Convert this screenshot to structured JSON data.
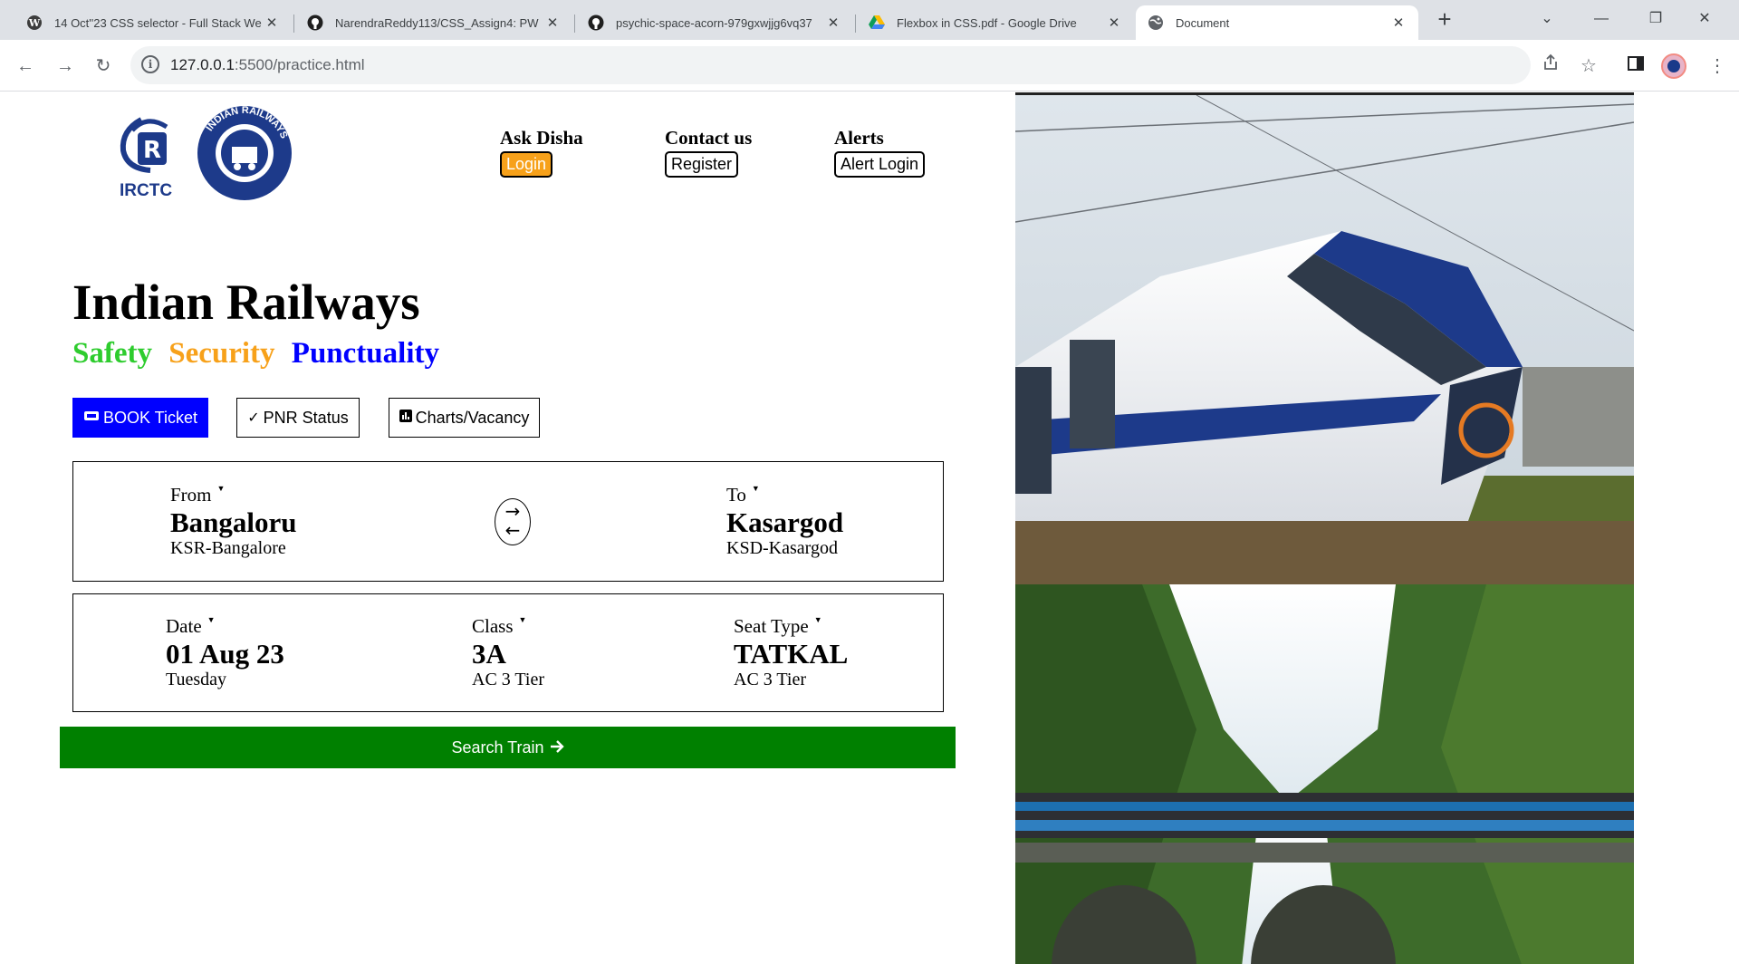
{
  "browser": {
    "tabs": [
      {
        "title": "14 Oct''23 CSS selector - Full Stack We",
        "icon": "wordpress-icon"
      },
      {
        "title": "NarendraReddy113/CSS_Assign4: PW",
        "icon": "github-icon"
      },
      {
        "title": "psychic-space-acorn-979gxwjjg6vq37",
        "icon": "github-icon"
      },
      {
        "title": "Flexbox in CSS.pdf - Google Drive",
        "icon": "google-drive-icon"
      },
      {
        "title": "Document",
        "icon": "globe-icon"
      }
    ],
    "address": {
      "host": "127.0.0.1",
      "path": ":5500/practice.html"
    }
  },
  "logo": {
    "text": "IRCTC",
    "ring_text": "INDIAN RAILWAYS"
  },
  "nav": [
    {
      "heading": "Ask Disha",
      "button": "Login"
    },
    {
      "heading": "Contact us",
      "button": "Register"
    },
    {
      "heading": "Alerts",
      "button": "Alert Login"
    }
  ],
  "headline": "Indian Railways",
  "motto": {
    "safety": "Safety",
    "security": "Security",
    "punctuality": "Punctuality",
    "colors": {
      "safety": "#2ecc2e",
      "security": "#f7a11a",
      "punctuality": "#0000ff"
    }
  },
  "actions": {
    "book": "BOOK Ticket",
    "pnr": "PNR Status",
    "charts": "Charts/Vacancy"
  },
  "journey": {
    "from": {
      "label": "From",
      "city": "Bangaloru",
      "station": "KSR-Bangalore"
    },
    "to": {
      "label": "To",
      "city": "Kasargod",
      "station": "KSD-Kasargod"
    },
    "swap_top": "→",
    "swap_bottom": "←"
  },
  "options": {
    "date": {
      "label": "Date",
      "value": "01 Aug 23",
      "sub": "Tuesday"
    },
    "class": {
      "label": "Class",
      "value": "3A",
      "sub": "AC 3 Tier"
    },
    "seat": {
      "label": "Seat Type",
      "value": "TATKAL",
      "sub": "AC 3 Tier"
    }
  },
  "search": {
    "label": "Search Train",
    "icon": "arrow-right-icon"
  },
  "colors": {
    "book_button": "#0000ff",
    "search_button": "#008000",
    "login_button": "#f7a11a"
  }
}
